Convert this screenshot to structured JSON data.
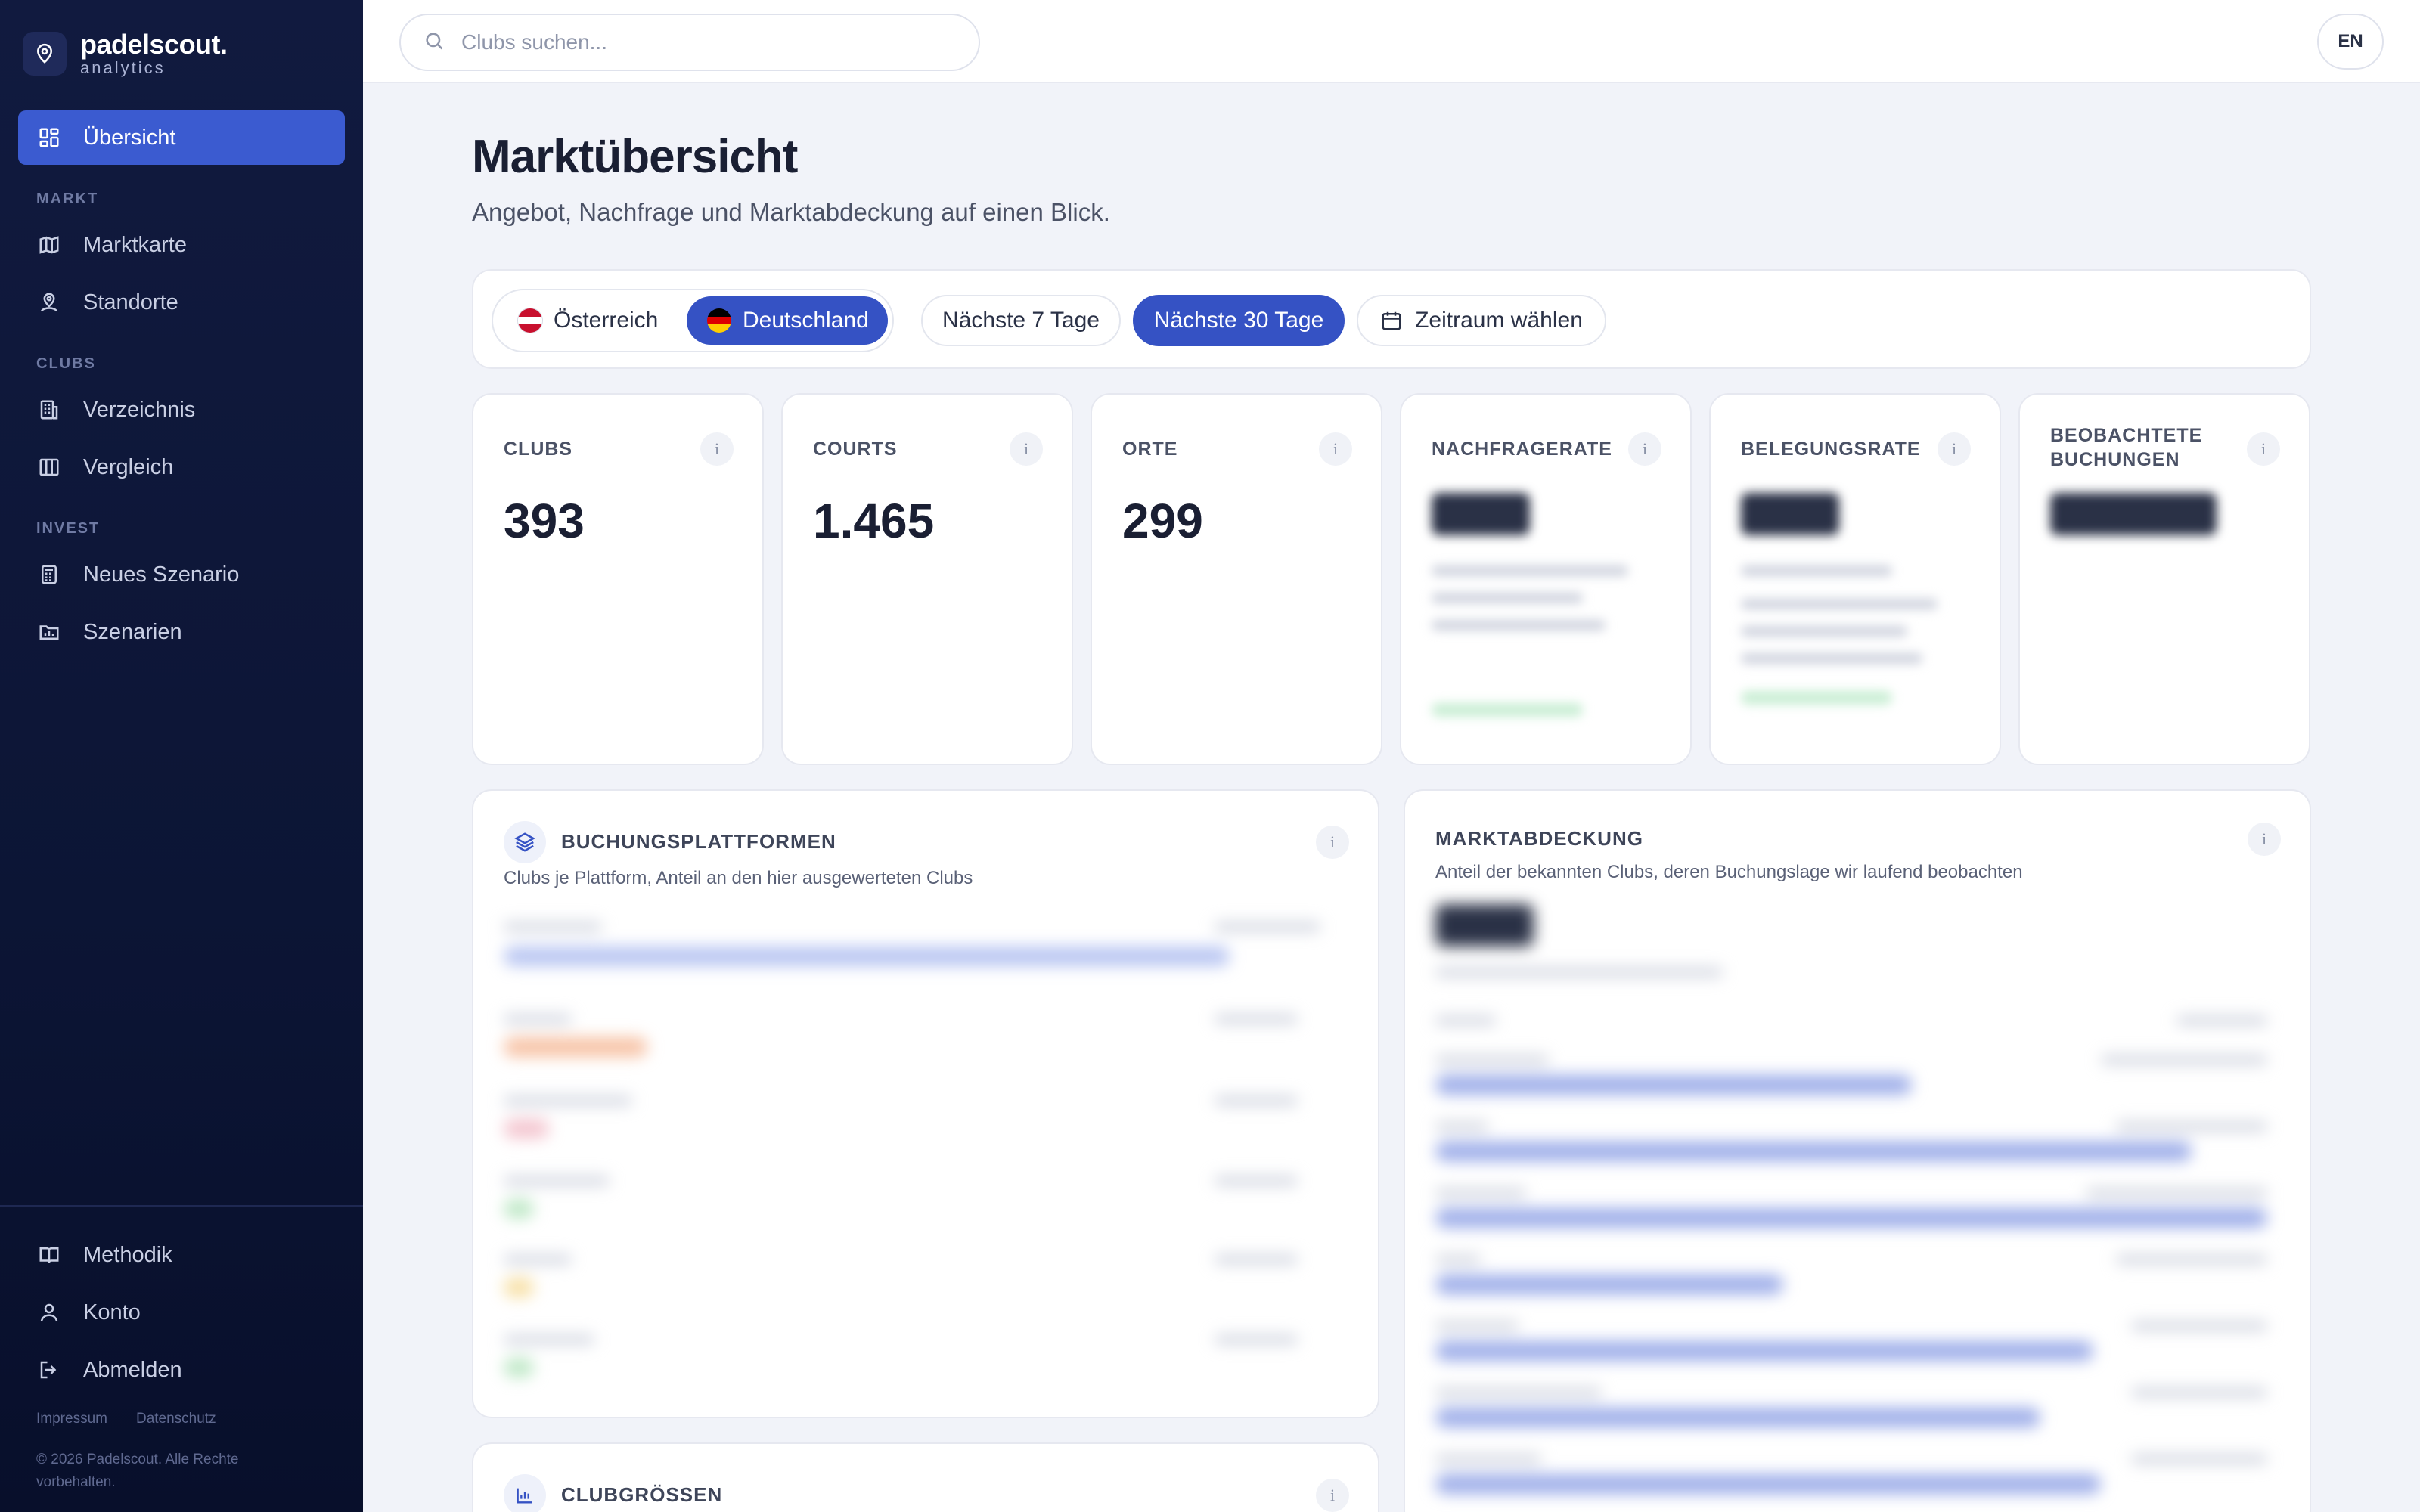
{
  "brand": {
    "name": "padelscout.",
    "sub": "analytics"
  },
  "sidebar": {
    "active_item": "Übersicht",
    "sections": [
      {
        "label": "MARKT",
        "items": [
          "Marktkarte",
          "Standorte"
        ]
      },
      {
        "label": "CLUBS",
        "items": [
          "Verzeichnis",
          "Vergleich"
        ]
      },
      {
        "label": "INVEST",
        "items": [
          "Neues Szenario",
          "Szenarien"
        ]
      }
    ],
    "bottom_items": [
      "Methodik",
      "Konto",
      "Abmelden"
    ],
    "footer_links": [
      "Impressum",
      "Datenschutz"
    ],
    "copyright": "© 2026 Padelscout. Alle Rechte vorbehalten."
  },
  "topbar": {
    "search_placeholder": "Clubs suchen...",
    "language": "EN"
  },
  "page": {
    "title": "Marktübersicht",
    "subtitle": "Angebot, Nachfrage und Marktabdeckung auf einen Blick."
  },
  "filters": {
    "countries": [
      {
        "label": "Österreich",
        "selected": false
      },
      {
        "label": "Deutschland",
        "selected": true
      }
    ],
    "periods": [
      {
        "label": "Nächste 7 Tage",
        "selected": false
      },
      {
        "label": "Nächste 30 Tage",
        "selected": true
      }
    ],
    "custom_range": "Zeitraum wählen"
  },
  "kpis": [
    {
      "label": "CLUBS",
      "value": "393"
    },
    {
      "label": "COURTS",
      "value": "1.465"
    },
    {
      "label": "ORTE",
      "value": "299"
    },
    {
      "label": "NACHFRAGERATE",
      "value": ""
    },
    {
      "label": "BELEGUNGSRATE",
      "value": ""
    },
    {
      "label": "BEOBACHTETE BUCHUNGEN",
      "value": ""
    }
  ],
  "panels": {
    "platforms": {
      "title": "BUCHUNGSPLATTFORMEN",
      "subtitle": "Clubs je Plattform, Anteil an den hier ausgewerteten Clubs"
    },
    "coverage": {
      "title": "MARKTABDECKUNG",
      "subtitle": "Anteil der bekannten Clubs, deren Buchungslage wir laufend beobachten"
    },
    "club_sizes": {
      "title": "CLUBGRÖSSEN"
    }
  },
  "info_glyph": "i",
  "colors": {
    "sidebar_bg": "#0c1535",
    "accent": "#3552c4",
    "page_bg": "#f1f3f9"
  }
}
